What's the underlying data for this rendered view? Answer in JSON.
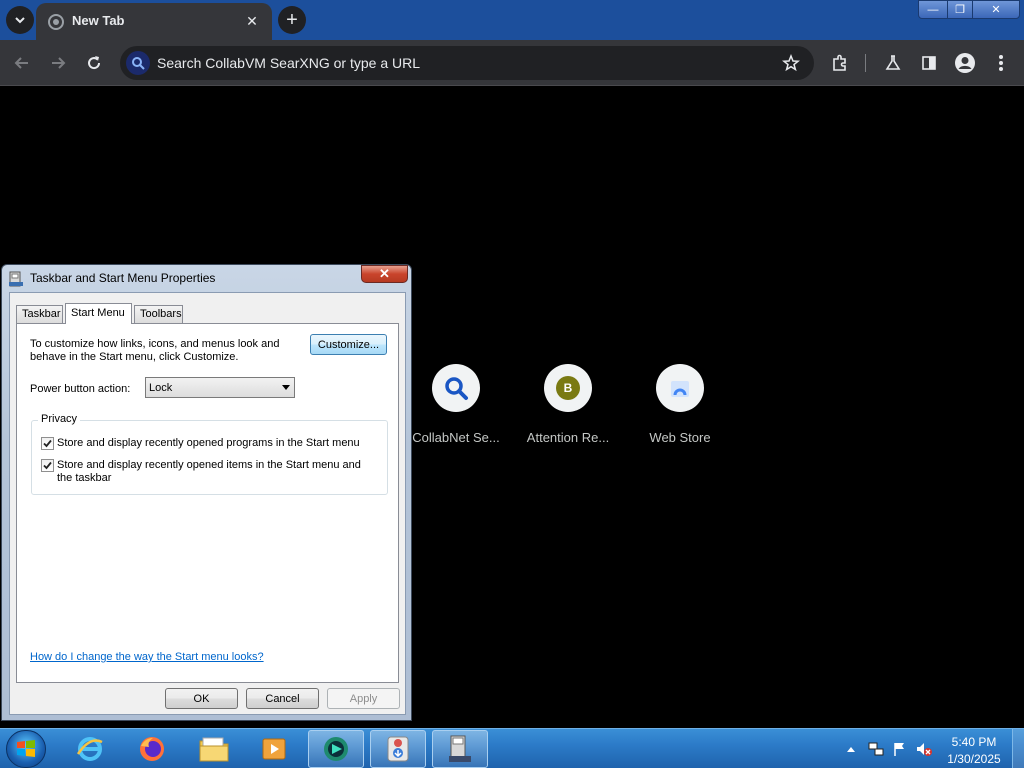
{
  "browser": {
    "tab_title": "New Tab",
    "new_tab_symbol": "+",
    "tab_close_symbol": "✕",
    "omnibox_placeholder": "Search CollabVM SearXNG or type a URL",
    "window_controls": {
      "minimize": "—",
      "maximize": "❐",
      "close": "✕"
    },
    "toolbar_icons": [
      "back-icon",
      "forward-icon",
      "reload-icon",
      "star-icon",
      "extensions-icon",
      "labs-icon",
      "side-panel-icon",
      "profile-icon",
      "menu-icon"
    ]
  },
  "shortcuts": [
    {
      "label": "CollabNet Se...",
      "icon": "search-icon"
    },
    {
      "label": "Attention Re...",
      "letter": "B",
      "color": "#7a7a12"
    },
    {
      "label": "Web Store",
      "icon": "web-store-icon"
    }
  ],
  "dialog": {
    "title": "Taskbar and Start Menu Properties",
    "close_symbol": "✕",
    "tabs": [
      "Taskbar",
      "Start Menu",
      "Toolbars"
    ],
    "active_tab": "Start Menu",
    "description": "To customize how links, icons, and menus look and behave in the Start menu, click Customize.",
    "customize_button": "Customize...",
    "power_button_label": "Power button action:",
    "power_button_value": "Lock",
    "privacy_group_label": "Privacy",
    "checkboxes": [
      {
        "label": "Store and display recently opened programs in the Start menu",
        "checked": true
      },
      {
        "label": "Store and display recently opened items in the Start menu and the taskbar",
        "checked": true
      }
    ],
    "help_link": "How do I change the way the Start menu looks?",
    "buttons": {
      "ok": "OK",
      "cancel": "Cancel",
      "apply": "Apply"
    }
  },
  "taskbar": {
    "apps": [
      "internet-explorer-icon",
      "firefox-icon",
      "file-explorer-icon",
      "media-player-icon",
      "collabvm-icon",
      "installer-icon",
      "taskbar-properties-icon"
    ],
    "clock_time": "5:40 PM",
    "clock_date": "1/30/2025"
  }
}
